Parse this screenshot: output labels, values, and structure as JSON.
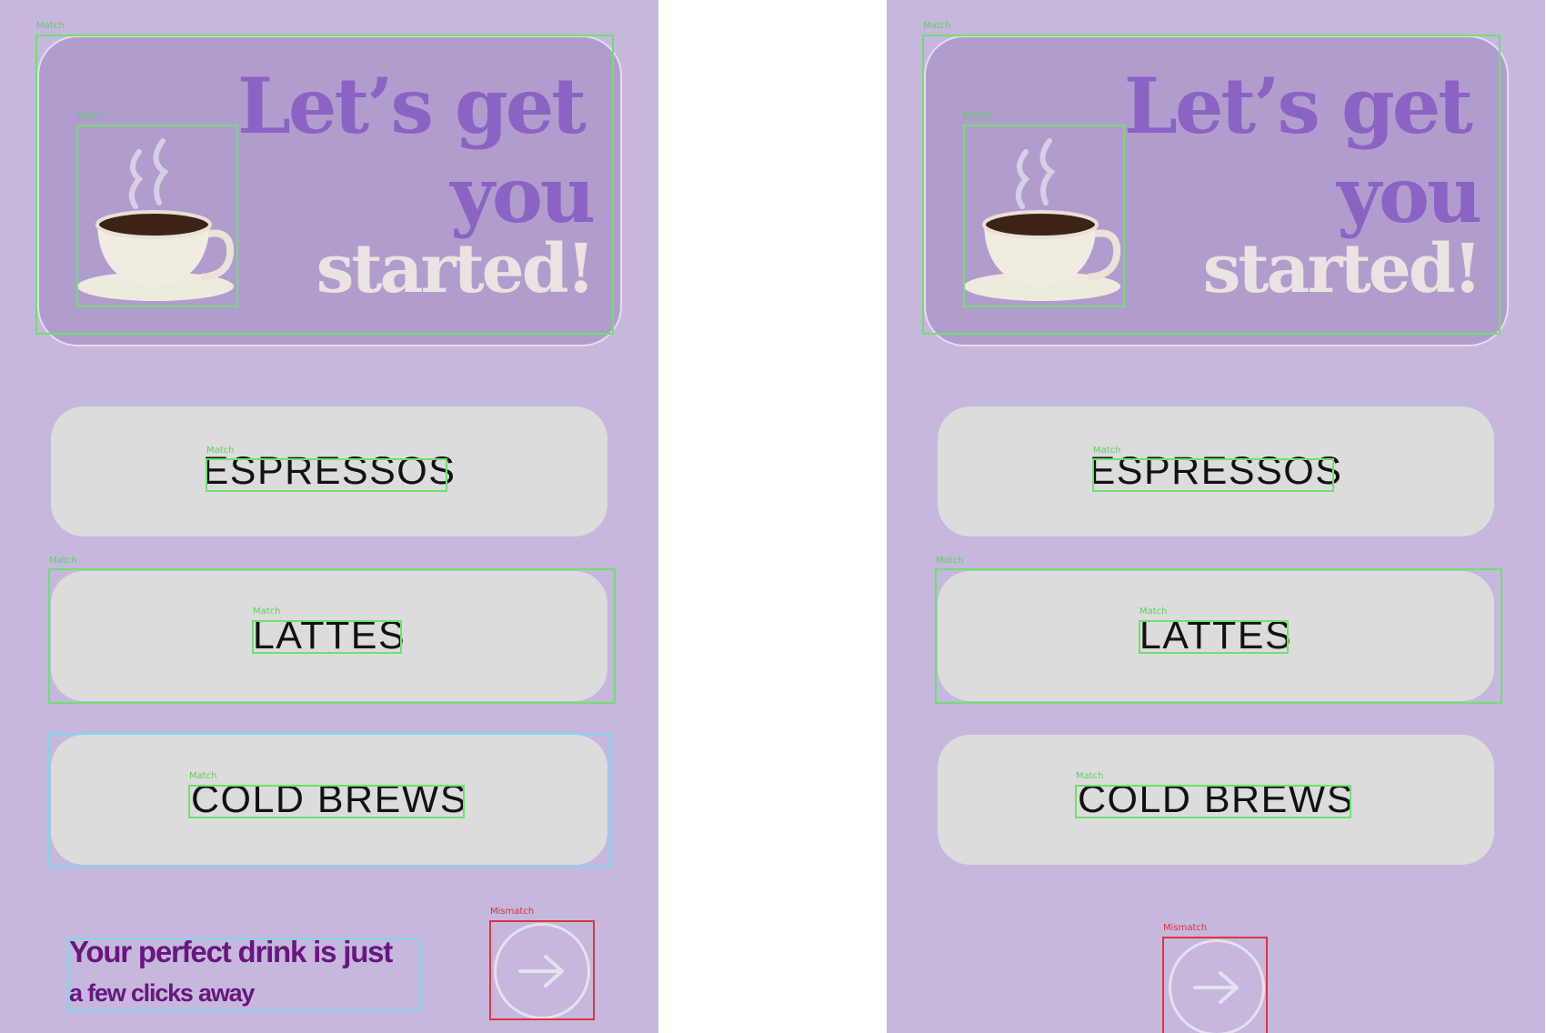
{
  "hero": {
    "line1": "Let’s get",
    "line2": "you",
    "line3": "started!",
    "cup_icon": "coffee-cup-icon"
  },
  "categories": [
    {
      "label": "ESPRESSOS"
    },
    {
      "label": "LATTES"
    },
    {
      "label": "COLD BREWS"
    }
  ],
  "footer": {
    "tagline_line1": "Your perfect drink is just",
    "tagline_line2": "a few clicks away",
    "next_icon": "arrow-right-icon"
  },
  "annotations": {
    "match": "Match",
    "mismatch": "Mismatch"
  },
  "colors": {
    "panel_bg": "#c5b8dc",
    "hero_bg": "#b09dcd",
    "title_purple": "#8a63c4",
    "title_cream": "#e9e3e1",
    "button_bg": "#dcdcdc",
    "tagline": "#6a1580",
    "match": "#6fe06f",
    "mismatch": "#e0333f",
    "unmatched": "#7fd7ee"
  }
}
